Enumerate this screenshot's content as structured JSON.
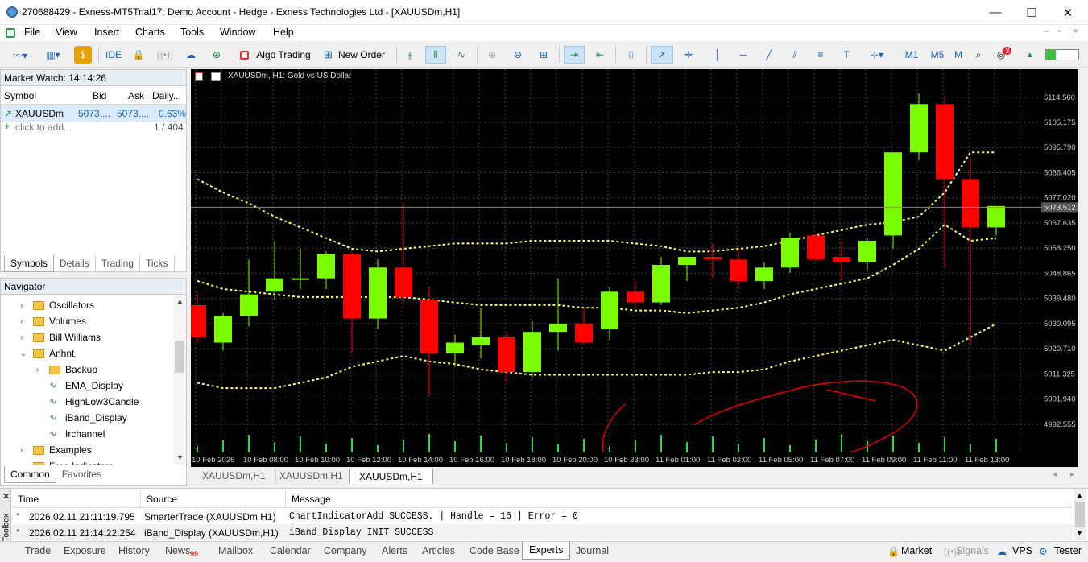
{
  "window": {
    "title": "270688429 - Exness-MT5Trial17: Demo Account - Hedge - Exness Technologies Ltd - [XAUUSDm,H1]"
  },
  "menu": [
    "File",
    "View",
    "Insert",
    "Charts",
    "Tools",
    "Window",
    "Help"
  ],
  "toolbar": {
    "ide": "IDE",
    "algo": "Algo Trading",
    "new_order": "New Order",
    "tf": [
      "M1",
      "M5",
      "M"
    ],
    "alert_count": "3"
  },
  "market_watch": {
    "title": "Market Watch: 14:14:26",
    "headers": [
      "Symbol",
      "Bid",
      "Ask",
      "Daily..."
    ],
    "rows": [
      {
        "symbol": "XAUUSDm",
        "bid": "5073....",
        "ask": "5073....",
        "daily": "0.63%"
      }
    ],
    "add": "click to add...",
    "count": "1 / 404",
    "tabs": [
      "Symbols",
      "Details",
      "Trading",
      "Ticks"
    ]
  },
  "navigator": {
    "title": "Navigator",
    "items": [
      {
        "label": "Oscillators",
        "level": 1,
        "type": "folder",
        "chev": "›"
      },
      {
        "label": "Volumes",
        "level": 1,
        "type": "folder",
        "chev": "›"
      },
      {
        "label": "Bill Williams",
        "level": 1,
        "type": "folder",
        "chev": "›"
      },
      {
        "label": "Anhnt",
        "level": 1,
        "type": "folder",
        "chev": "⌄"
      },
      {
        "label": "Backup",
        "level": 2,
        "type": "folder",
        "chev": "›"
      },
      {
        "label": "EMA_Display",
        "level": 2,
        "type": "ind",
        "chev": ""
      },
      {
        "label": "HighLow3Candle",
        "level": 2,
        "type": "ind",
        "chev": ""
      },
      {
        "label": "iBand_Display",
        "level": 2,
        "type": "ind",
        "chev": ""
      },
      {
        "label": "Irchannel",
        "level": 2,
        "type": "ind",
        "chev": ""
      },
      {
        "label": "Examples",
        "level": 1,
        "type": "folder",
        "chev": "›"
      },
      {
        "label": "Free Indicators",
        "level": 1,
        "type": "folder",
        "chev": "›"
      }
    ],
    "tabs": [
      "Common",
      "Favorites"
    ]
  },
  "chart": {
    "header": "XAUUSDm, H1:  Gold vs US Dollar",
    "price_labels": [
      "5114.560",
      "5105.175",
      "5095.790",
      "5086.405",
      "5077.020",
      "5067.635",
      "5058.250",
      "5048.865",
      "5039.480",
      "5030.095",
      "5020.710",
      "5011.325",
      "5001.940",
      "4992.555"
    ],
    "current_price": "5073.512",
    "time_labels": [
      "10 Feb 2026",
      "10 Feb 08:00",
      "10 Feb 10:00",
      "10 Feb 12:00",
      "10 Feb 14:00",
      "10 Feb 16:00",
      "10 Feb 18:00",
      "10 Feb 20:00",
      "10 Feb 23:00",
      "11 Feb 01:00",
      "11 Feb 03:00",
      "11 Feb 05:00",
      "11 Feb 07:00",
      "11 Feb 09:00",
      "11 Feb 11:00",
      "11 Feb 13:00"
    ],
    "tabs": [
      "XAUUSDm,H1",
      "XAUUSDm,H1",
      "XAUUSDm,H1"
    ],
    "colors": {
      "bull": "#7cfc00",
      "bear": "#ff0000",
      "band": "#ffff66",
      "grid": "#3a4a4a",
      "annotation": "#dd0000"
    }
  },
  "chart_data": {
    "type": "candlestick",
    "title": "XAUUSDm, H1:  Gold vs US Dollar",
    "ylim": [
      4985,
      5122
    ],
    "candles": [
      {
        "o": 5037,
        "h": 5042,
        "l": 5023,
        "c": 5025
      },
      {
        "o": 5023,
        "h": 5034,
        "l": 5020,
        "c": 5033
      },
      {
        "o": 5033,
        "h": 5054,
        "l": 5029,
        "c": 5041
      },
      {
        "o": 5042,
        "h": 5061,
        "l": 5039,
        "c": 5047
      },
      {
        "o": 5047,
        "h": 5058,
        "l": 5043,
        "c": 5047
      },
      {
        "o": 5047,
        "h": 5057,
        "l": 5043,
        "c": 5056
      },
      {
        "o": 5056,
        "h": 5057,
        "l": 5019,
        "c": 5032
      },
      {
        "o": 5032,
        "h": 5054,
        "l": 5028,
        "c": 5051
      },
      {
        "o": 5051,
        "h": 5075,
        "l": 5038,
        "c": 5040
      },
      {
        "o": 5039,
        "h": 5044,
        "l": 5003,
        "c": 5019
      },
      {
        "o": 5019,
        "h": 5026,
        "l": 5014,
        "c": 5023
      },
      {
        "o": 5022,
        "h": 5036,
        "l": 5017,
        "c": 5025
      },
      {
        "o": 5025,
        "h": 5027,
        "l": 5008,
        "c": 5012
      },
      {
        "o": 5012,
        "h": 5031,
        "l": 5010,
        "c": 5027
      },
      {
        "o": 5027,
        "h": 5047,
        "l": 5020,
        "c": 5030
      },
      {
        "o": 5030,
        "h": 5036,
        "l": 5022,
        "c": 5023
      },
      {
        "o": 5028,
        "h": 5044,
        "l": 5024,
        "c": 5042
      },
      {
        "o": 5042,
        "h": 5046,
        "l": 5036,
        "c": 5038
      },
      {
        "o": 5038,
        "h": 5055,
        "l": 5037,
        "c": 5052
      },
      {
        "o": 5052,
        "h": 5054,
        "l": 5046,
        "c": 5055
      },
      {
        "o": 5055,
        "h": 5060,
        "l": 5047,
        "c": 5054
      },
      {
        "o": 5054,
        "h": 5058,
        "l": 5043,
        "c": 5046
      },
      {
        "o": 5046,
        "h": 5053,
        "l": 5043,
        "c": 5051
      },
      {
        "o": 5051,
        "h": 5064,
        "l": 5049,
        "c": 5062
      },
      {
        "o": 5063,
        "h": 5064,
        "l": 5053,
        "c": 5054
      },
      {
        "o": 5055,
        "h": 5061,
        "l": 5046,
        "c": 5053
      },
      {
        "o": 5053,
        "h": 5062,
        "l": 5050,
        "c": 5061
      },
      {
        "o": 5063,
        "h": 5086,
        "l": 5058,
        "c": 5094
      },
      {
        "o": 5094,
        "h": 5116,
        "l": 5091,
        "c": 5112
      },
      {
        "o": 5112,
        "h": 5115,
        "l": 5051,
        "c": 5084
      },
      {
        "o": 5084,
        "h": 5092,
        "l": 5022,
        "c": 5066
      },
      {
        "o": 5066,
        "h": 5072,
        "l": 5063,
        "c": 5074
      }
    ],
    "bands": {
      "upper": [
        5084,
        5079,
        5075,
        5070,
        5066,
        5062,
        5058,
        5057,
        5058,
        5059,
        5060,
        5060,
        5060,
        5061,
        5061,
        5061,
        5061,
        5060,
        5059,
        5057,
        5057,
        5058,
        5059,
        5061,
        5063,
        5065,
        5067,
        5068,
        5070,
        5079,
        5094,
        5094
      ],
      "middle": [
        5046,
        5043,
        5042,
        5041,
        5040,
        5040,
        5040,
        5040,
        5040,
        5039,
        5038,
        5037,
        5037,
        5037,
        5037,
        5036,
        5036,
        5035,
        5035,
        5034,
        5035,
        5036,
        5038,
        5041,
        5043,
        5045,
        5047,
        5052,
        5058,
        5067,
        5061,
        5062
      ],
      "lower": [
        5008,
        5006,
        5006,
        5006,
        5008,
        5010,
        5014,
        5016,
        5018,
        5016,
        5015,
        5013,
        5012,
        5011,
        5011,
        5011,
        5011,
        5011,
        5011,
        5011,
        5012,
        5012,
        5013,
        5016,
        5018,
        5020,
        5022,
        5024,
        5022,
        5020,
        5025,
        5030
      ]
    }
  },
  "toolbox": {
    "headers": [
      "Time",
      "Source",
      "Message"
    ],
    "rows": [
      {
        "time": "2026.02.11 21:11:19.795",
        "source": "SmarterTrade (XAUUSDm,H1)",
        "message": "ChartIndicatorAdd SUCCESS. | Handle = 16 | Error = 0"
      },
      {
        "time": "2026.02.11 21:14:22.254",
        "source": "iBand_Display (XAUUSDm,H1)",
        "message": "iBand_Display INIT SUCCESS"
      }
    ],
    "side_label": "Toolbox"
  },
  "bottom_tabs": [
    "Trade",
    "Exposure",
    "History",
    "News",
    "Mailbox",
    "Calendar",
    "Company",
    "Alerts",
    "Articles",
    "Code Base",
    "Experts",
    "Journal"
  ],
  "news_badge": "99",
  "status": {
    "market": "Market",
    "signals": "Signals",
    "vps": "VPS",
    "tester": "Tester"
  }
}
